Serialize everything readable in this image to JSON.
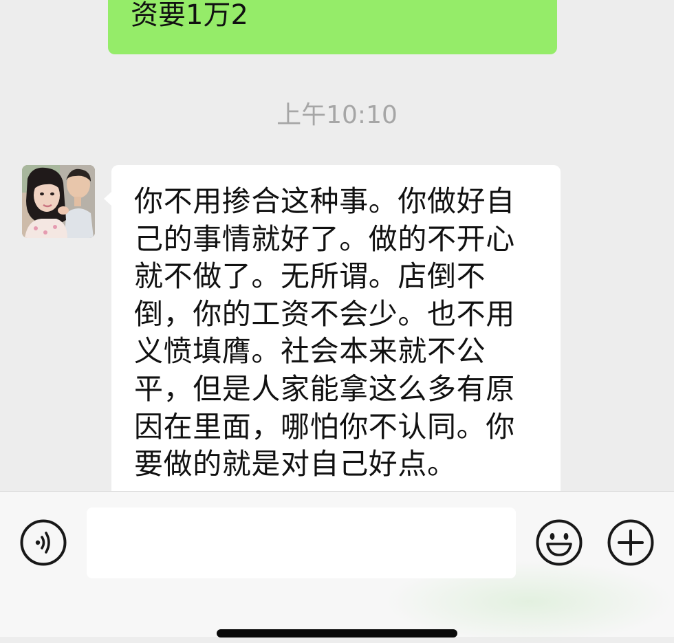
{
  "chat": {
    "messages": [
      {
        "direction": "sent",
        "text": "资要1万2"
      },
      {
        "direction": "received",
        "text": "你不用掺合这种事。你做好自己的事情就好了。做的不开心就不做了。无所谓。店倒不倒，你的工资不会少。也不用义愤填膺。社会本来就不公平，但是人家能拿这么多有原因在里面，哪怕你不认同。你要做的就是对自己好点。"
      }
    ],
    "timestamp": "上午10:10"
  },
  "input_bar": {
    "voice_icon": "voice-icon",
    "emoji_icon": "emoji-icon",
    "plus_icon": "plus-icon",
    "input_value": ""
  },
  "colors": {
    "sent_bubble": "#95ec69",
    "received_bubble": "#ffffff",
    "chat_background": "#ededed",
    "input_bar_background": "#f7f7f7",
    "timestamp_text": "#a6a6a6"
  }
}
